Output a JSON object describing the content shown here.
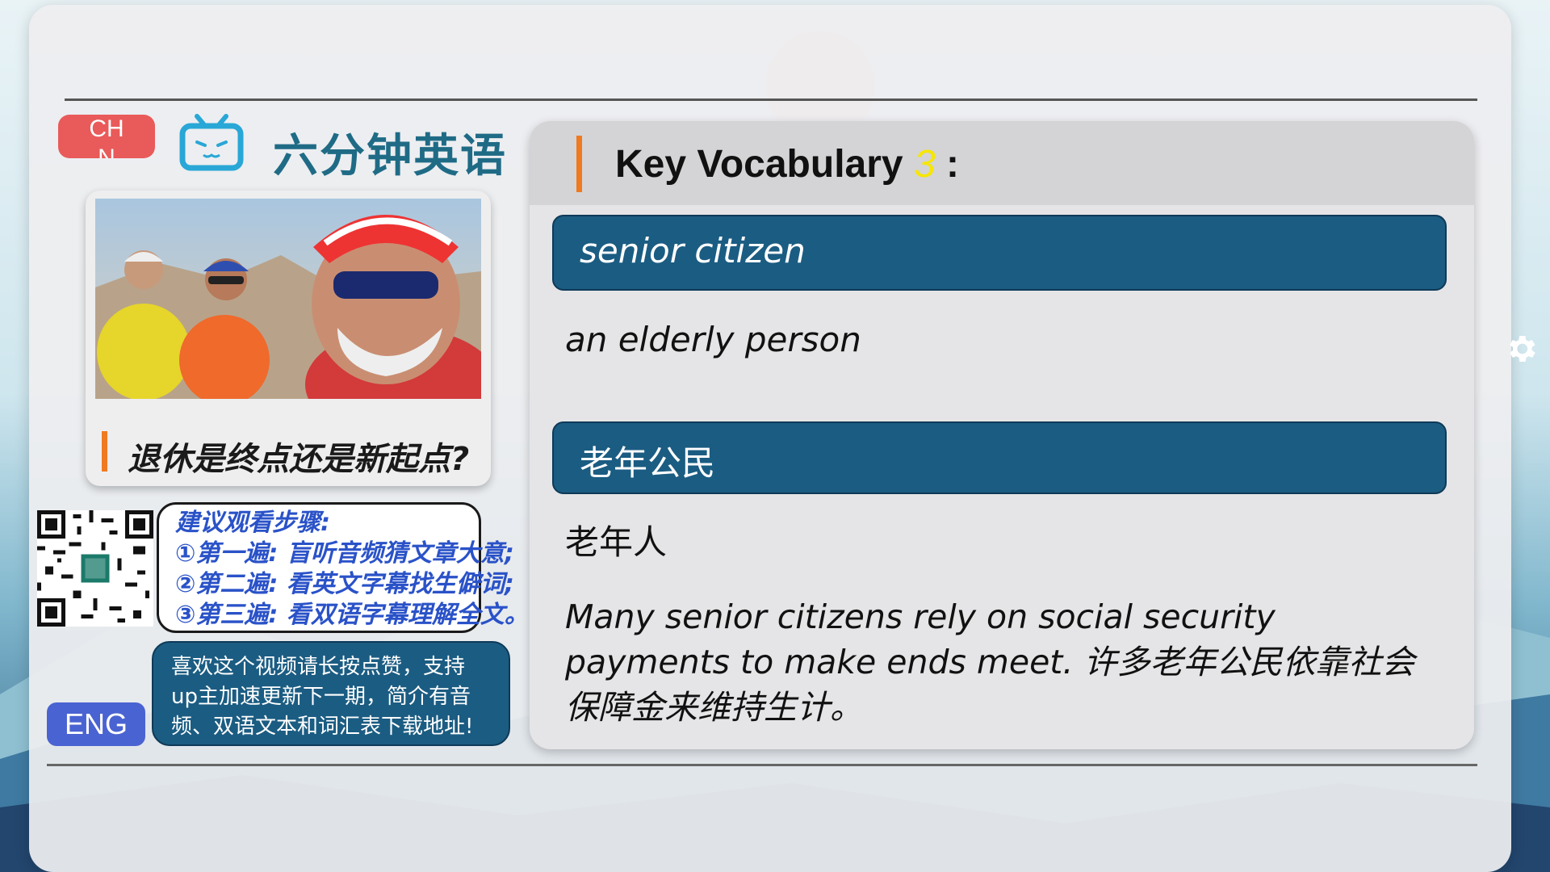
{
  "header": {
    "chn_button": "CHN",
    "brand": "六分钟英语"
  },
  "story": {
    "title": "退休是终点还是新起点?"
  },
  "steps": {
    "lines": [
      "建议观看步骤:",
      "①第一遍: 盲听音频猜文章大意;",
      "②第二遍: 看英文字幕找生僻词;",
      "③第三遍: 看双语字幕理解全文。"
    ]
  },
  "like_box": {
    "lines": [
      "喜欢这个视频请长按点赞，支持",
      "up主加速更新下一期，简介有音",
      "频、双语文本和词汇表下载地址!"
    ]
  },
  "eng_button": "ENG",
  "vocab": {
    "heading": "Key Vocabulary",
    "number": "3",
    "colon": ":",
    "term_en": "senior citizen",
    "def_en": "an elderly person",
    "term_cn": "老年公民",
    "def_cn": "老年人",
    "example": "Many senior citizens rely on social security payments to make ends meet. 许多老年公民依靠社会保障金来维持生计。"
  },
  "colors": {
    "accent_orange": "#f07a20",
    "term_bg": "#1b5c82",
    "chn_red": "#e95a5a",
    "eng_blue": "#4a63d2",
    "steps_text": "#2a52c8"
  },
  "icons": [
    "tv-icon",
    "gear-icon",
    "qr-code"
  ]
}
